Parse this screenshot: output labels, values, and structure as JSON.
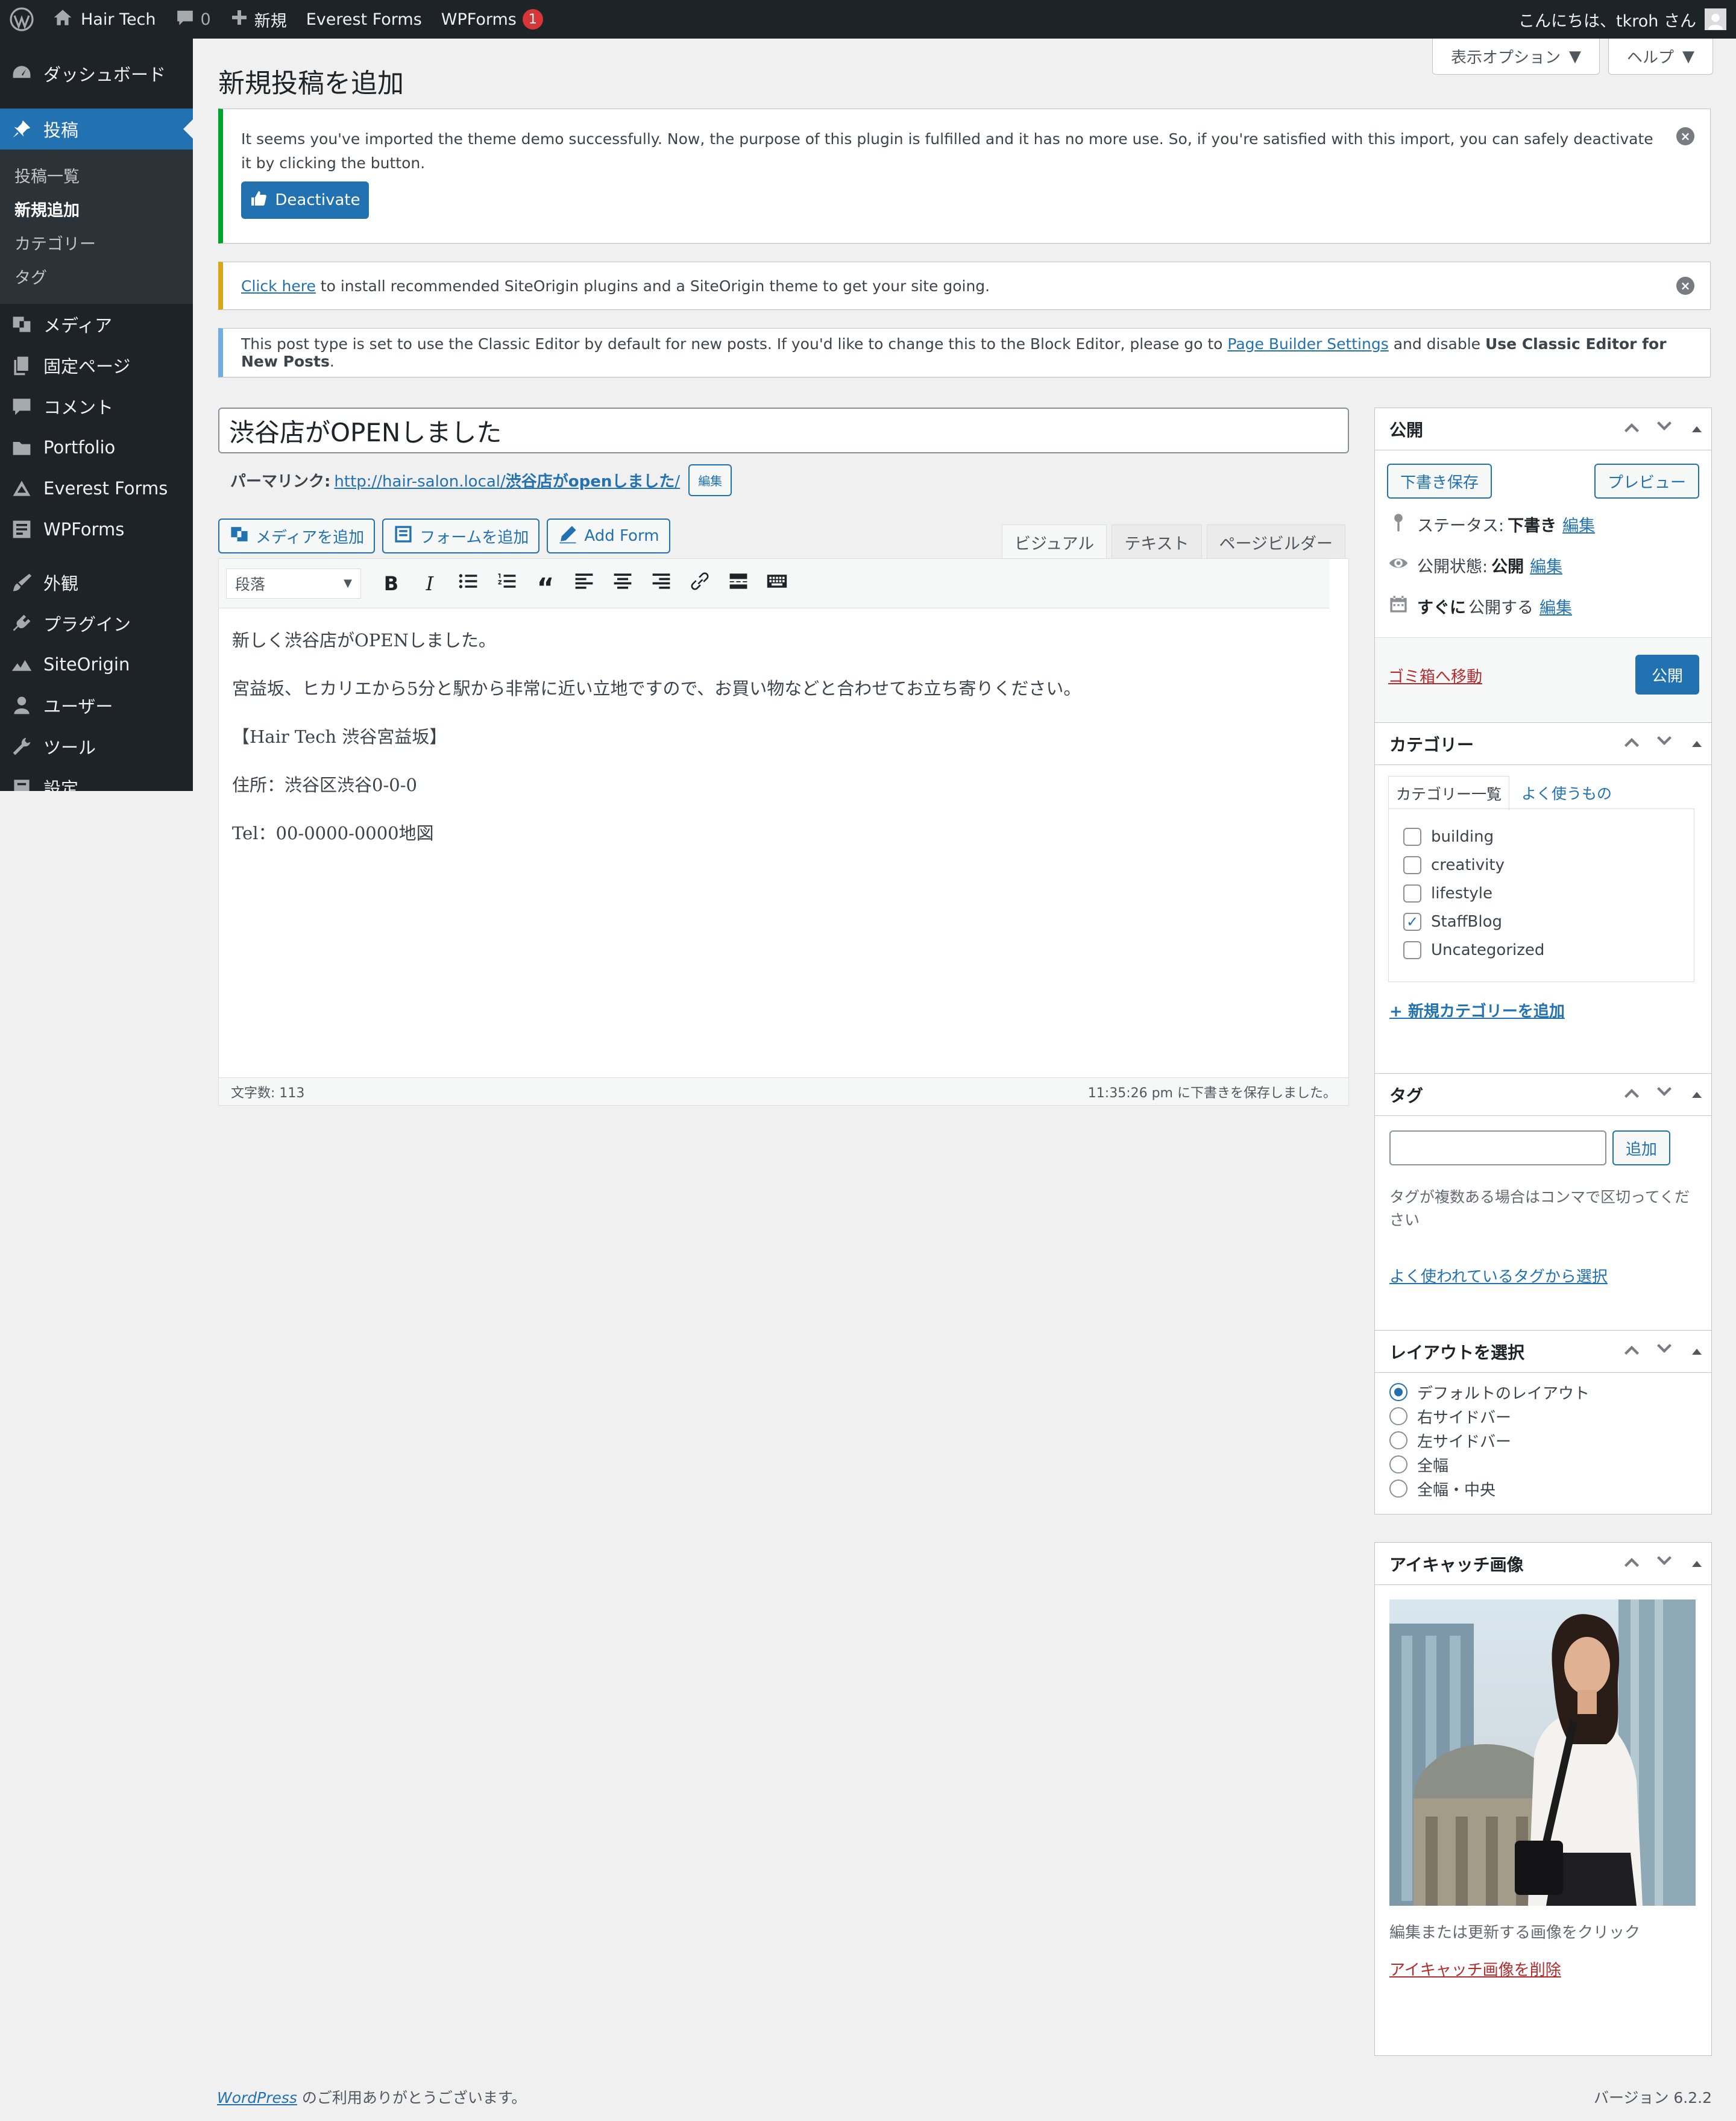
{
  "adminbar": {
    "site_name": "Hair Tech",
    "comments_count": "0",
    "new_label": "新規",
    "everest_forms": "Everest Forms",
    "wpforms": "WPForms",
    "wpforms_badge": "1",
    "greeting": "こんにちは、tkroh さん"
  },
  "sidebar": {
    "dashboard": "ダッシュボード",
    "posts": "投稿",
    "posts_sub": [
      "投稿一覧",
      "新規追加",
      "カテゴリー",
      "タグ"
    ],
    "media": "メディア",
    "pages": "固定ページ",
    "comments": "コメント",
    "portfolio": "Portfolio",
    "everest_forms": "Everest Forms",
    "wpforms": "WPForms",
    "appearance": "外観",
    "plugins": "プラグイン",
    "siteorigin": "SiteOrigin",
    "users": "ユーザー",
    "tools": "ツール",
    "settings": "設定"
  },
  "header": {
    "page_title": "新規投稿を追加",
    "screen_options": "表示オプション",
    "help": "ヘルプ"
  },
  "notices": {
    "demo_text": "It seems you've imported the theme demo successfully. Now, the purpose of this plugin is fulfilled and it has no more use. So, if you're satisfied with this import, you can safely deactivate it by clicking the button.",
    "deactivate": "Deactivate",
    "siteorigin_link": "Click here",
    "siteorigin_text": " to install recommended SiteOrigin plugins and a SiteOrigin theme to get your site going.",
    "classic_text_1": "This post type is set to use the Classic Editor by default for new posts. If you'd like to change this to the Block Editor, please go to ",
    "classic_link": "Page Builder Settings",
    "classic_text_2": " and disable ",
    "classic_bold": "Use Classic Editor for New Posts",
    "classic_text_3": "."
  },
  "post": {
    "title": "渋谷店がOPENしました",
    "permalink_label": "パーマリンク:",
    "permalink_base": "http://hair-salon.local/",
    "permalink_slug": "渋谷店がopenしました",
    "permalink_tail": "/",
    "edit": "編集"
  },
  "media_buttons": {
    "add_media": "メディアを追加",
    "add_form_jp": "フォームを追加",
    "add_form": "Add Form"
  },
  "editor_tabs": [
    "ビジュアル",
    "テキスト",
    "ページビルダー"
  ],
  "toolbar": {
    "format": "段落"
  },
  "content": [
    "新しく渋谷店がOPENしました。",
    "宮益坂、ヒカリエから5分と駅から非常に近い立地ですので、お買い物などと合わせてお立ち寄りください。",
    "【Hair Tech 渋谷宮益坂】",
    "住所：渋谷区渋谷0-0-0",
    "Tel：00-0000-0000地図"
  ],
  "statusbar": {
    "word_count": "文字数: 113",
    "saved": "11:35:26 pm に下書きを保存しました。"
  },
  "publish": {
    "title": "公開",
    "save_draft": "下書き保存",
    "preview": "プレビュー",
    "status_label": "ステータス:",
    "status_value": "下書き",
    "visibility_label": "公開状態:",
    "visibility_value": "公開",
    "schedule_value": "すぐに",
    "schedule_label": "公開する",
    "edit": "編集",
    "trash": "ゴミ箱へ移動",
    "publish_btn": "公開"
  },
  "categories": {
    "title": "カテゴリー",
    "tab_all": "カテゴリー一覧",
    "tab_popular": "よく使うもの",
    "items": [
      {
        "label": "building",
        "checked": false
      },
      {
        "label": "creativity",
        "checked": false
      },
      {
        "label": "lifestyle",
        "checked": false
      },
      {
        "label": "StaffBlog",
        "checked": true
      },
      {
        "label": "Uncategorized",
        "checked": false
      }
    ],
    "add_new": "+ 新規カテゴリーを追加"
  },
  "tags": {
    "title": "タグ",
    "add": "追加",
    "hint": "タグが複数ある場合はコンマで区切ってください",
    "choose": "よく使われているタグから選択"
  },
  "layout": {
    "title": "レイアウトを選択",
    "options": [
      {
        "label": "デフォルトのレイアウト",
        "checked": true
      },
      {
        "label": "右サイドバー",
        "checked": false
      },
      {
        "label": "左サイドバー",
        "checked": false
      },
      {
        "label": "全幅",
        "checked": false
      },
      {
        "label": "全幅・中央",
        "checked": false
      }
    ]
  },
  "featured": {
    "title": "アイキャッチ画像",
    "hint": "編集または更新する画像をクリック",
    "remove": "アイキャッチ画像を削除"
  },
  "footer": {
    "wp_link": "WordPress",
    "thanks": " のご利用ありがとうございます。",
    "version": "バージョン 6.2.2"
  }
}
